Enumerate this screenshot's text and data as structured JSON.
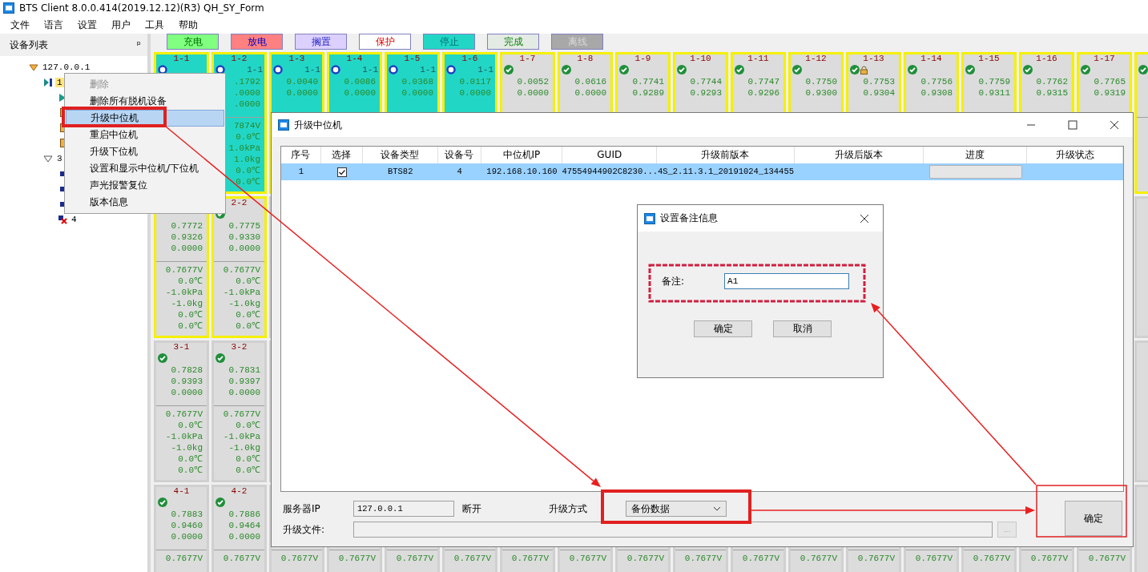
{
  "window": {
    "title": "BTS Client 8.0.0.414(2019.12.12)(R3) QH_SY_Form"
  },
  "menu_bar": [
    "文件",
    "语言",
    "设置",
    "用户",
    "工具",
    "帮助"
  ],
  "device_panel": {
    "title": "设备列表",
    "pin": "ᵖ",
    "nodes": [
      {
        "label": "127.0.0.1",
        "kind": "host",
        "expanded": true,
        "selected": false,
        "children": [
          {
            "label": "1",
            "kind": "unit",
            "selected": true,
            "children": [
              {
                "kind": "running",
                "selected": false
              },
              {
                "kind": "idle",
                "selected": false
              },
              {
                "kind": "idle",
                "selected": false
              },
              {
                "kind": "idle",
                "selected": false
              }
            ]
          },
          {
            "label": "3",
            "kind": "group",
            "expanded": true,
            "selected": false,
            "children": [
              {
                "kind": "channel",
                "selected": false
              },
              {
                "kind": "channel",
                "selected": false
              },
              {
                "kind": "channel",
                "selected": false
              },
              {
                "label": "4",
                "kind": "offline",
                "selected": false
              }
            ]
          }
        ]
      }
    ]
  },
  "context_menu": [
    {
      "label": "删除",
      "disabled": true,
      "selected": false
    },
    {
      "label": "删除所有脱机设备",
      "disabled": false,
      "selected": false
    },
    {
      "label": "升级中位机",
      "disabled": false,
      "selected": true
    },
    {
      "label": "重启中位机",
      "disabled": false,
      "selected": false
    },
    {
      "label": "升级下位机",
      "disabled": false,
      "selected": false
    },
    {
      "label": "设置和显示中位机/下位机",
      "disabled": false,
      "selected": false
    },
    {
      "label": "声光报警复位",
      "disabled": false,
      "selected": false
    },
    {
      "label": "版本信息",
      "disabled": false,
      "selected": false
    }
  ],
  "legend": [
    {
      "label": "充电",
      "color": "#80ff80"
    },
    {
      "label": "放电",
      "color": "#ff8080"
    },
    {
      "label": "搁置",
      "color": "#dcd0ff"
    },
    {
      "label": "保护",
      "color": "#ffffff"
    },
    {
      "label": "停止",
      "color": "#22d6c6"
    },
    {
      "label": "完成",
      "color": "#e4ebe4"
    },
    {
      "label": "离线",
      "color": "#a8a8a8"
    }
  ],
  "channel_grid": [
    [
      {
        "label": "1-1",
        "kind": "running",
        "selected": true,
        "locked": false
      },
      {
        "label": "1-2",
        "sub": "1-1",
        "kind": "running",
        "selected": true,
        "locked": false,
        "values": [
          ".1792",
          ".0000",
          ".0000"
        ],
        "readings": [
          "7874V",
          "0.0℃",
          "1.0kPa",
          "1.0kg",
          "0.0℃",
          "0.0℃"
        ]
      },
      {
        "label": "1-3",
        "sub": "1-1",
        "kind": "running",
        "selected": true,
        "locked": false,
        "values": [
          "0.0040",
          "0.0000"
        ]
      },
      {
        "label": "1-4",
        "sub": "1-1",
        "kind": "running",
        "selected": true,
        "locked": false,
        "values": [
          "0.0086",
          "0.0000"
        ]
      },
      {
        "label": "1-5",
        "sub": "1-1",
        "kind": "running",
        "selected": true,
        "locked": false,
        "values": [
          "0.0368",
          "0.0000"
        ]
      },
      {
        "label": "1-6",
        "sub": "1-1",
        "kind": "running",
        "selected": true,
        "locked": false,
        "values": [
          "0.0117",
          "0.0000"
        ]
      },
      {
        "label": "1-7",
        "kind": "done",
        "selected": true,
        "locked": false,
        "values": [
          "0.0052",
          "0.0000"
        ]
      },
      {
        "label": "1-8",
        "kind": "done",
        "selected": true,
        "locked": false,
        "values": [
          "0.0616",
          "0.0000"
        ]
      },
      {
        "label": "1-9",
        "kind": "done",
        "selected": true,
        "locked": false,
        "values": [
          "0.7741",
          "0.9289"
        ]
      },
      {
        "label": "1-10",
        "kind": "done",
        "selected": true,
        "locked": false,
        "values": [
          "0.7744",
          "0.9293"
        ]
      },
      {
        "label": "1-11",
        "kind": "done",
        "selected": true,
        "locked": false,
        "values": [
          "0.7747",
          "0.9296"
        ]
      },
      {
        "label": "1-12",
        "kind": "done",
        "selected": true,
        "locked": false,
        "values": [
          "0.7750",
          "0.9300"
        ]
      },
      {
        "label": "1-13",
        "kind": "done",
        "selected": true,
        "locked": true,
        "values": [
          "0.7753",
          "0.9304"
        ]
      },
      {
        "label": "1-14",
        "kind": "done",
        "selected": true,
        "locked": false,
        "values": [
          "0.7756",
          "0.9308"
        ]
      },
      {
        "label": "1-15",
        "kind": "done",
        "selected": true,
        "locked": false,
        "values": [
          "0.7759",
          "0.9311"
        ]
      },
      {
        "label": "1-16",
        "kind": "done",
        "selected": true,
        "locked": false,
        "values": [
          "0.7762",
          "0.9315"
        ]
      },
      {
        "label": "1-17",
        "kind": "done",
        "selected": true,
        "locked": false,
        "values": [
          "0.7765",
          "0.9319"
        ]
      },
      {
        "kind": "done",
        "selected": true
      }
    ],
    [
      {
        "selected": true,
        "values": [
          "0.7772",
          "0.9326",
          "0.0000"
        ],
        "readings": [
          "0.7677V",
          "0.0℃",
          "-1.0kPa",
          "-1.0kg",
          "0.0℃",
          "0.0℃"
        ]
      },
      {
        "label": "2-2",
        "kind": "done",
        "selected": true,
        "locked": false,
        "values": [
          "0.7775",
          "0.9330",
          "0.0000"
        ],
        "readings": [
          "0.7677V",
          "0.0℃",
          "-1.0kPa",
          "-1.0kg",
          "0.0℃",
          "0.0℃"
        ]
      }
    ],
    [
      {
        "label": "3-1",
        "kind": "done",
        "selected": false,
        "locked": false,
        "values": [
          "0.7828",
          "0.9393",
          "0.0000"
        ],
        "readings": [
          "0.7677V",
          "0.0℃",
          "-1.0kPa",
          "-1.0kg",
          "0.0℃",
          "0.0℃"
        ]
      },
      {
        "label": "3-2",
        "kind": "done",
        "selected": false,
        "locked": false,
        "values": [
          "0.7831",
          "0.9397",
          "0.0000"
        ],
        "readings": [
          "0.7677V",
          "0.0℃",
          "-1.0kPa",
          "-1.0kg",
          "0.0℃",
          "0.0℃"
        ]
      }
    ],
    [
      {
        "label": "4-1",
        "kind": "done",
        "selected": false,
        "locked": false,
        "values": [
          "0.7883",
          "0.9460",
          "0.0000"
        ],
        "readings": [
          "0.7677V"
        ]
      },
      {
        "label": "4-2",
        "kind": "done",
        "selected": false,
        "locked": false,
        "values": [
          "0.7886",
          "0.9464",
          "0.0000"
        ],
        "readings": [
          "0.7677V"
        ]
      },
      {
        "selected": false,
        "readings": [
          "0.7677V"
        ]
      },
      {
        "selected": false,
        "readings": [
          "0.7677V"
        ]
      },
      {
        "selected": false,
        "readings": [
          "0.7677V"
        ]
      },
      {
        "selected": false,
        "readings": [
          "0.7677V"
        ]
      },
      {
        "selected": false,
        "readings": [
          "0.7677V"
        ]
      },
      {
        "selected": false,
        "readings": [
          "0.7677V"
        ]
      },
      {
        "selected": false,
        "readings": [
          "0.7677V"
        ]
      },
      {
        "selected": false,
        "readings": [
          "0.7677V"
        ]
      },
      {
        "selected": false,
        "readings": [
          "0.7677V"
        ]
      },
      {
        "selected": false,
        "readings": [
          "0.7677V"
        ]
      },
      {
        "selected": false,
        "readings": [
          "0.7677V"
        ]
      },
      {
        "selected": false,
        "readings": [
          "0.7677V"
        ]
      },
      {
        "selected": false,
        "readings": [
          "0.7677V"
        ]
      },
      {
        "selected": false,
        "readings": [
          "0.7677V"
        ]
      },
      {
        "selected": false,
        "readings": [
          "0.7677V"
        ]
      }
    ]
  ],
  "upgrade_dialog": {
    "title": "升级中位机",
    "table": {
      "columns": [
        "序号",
        "选择",
        "设备类型",
        "设备号",
        "中位机IP",
        "GUID",
        "升级前版本",
        "升级后版本",
        "进度",
        "升级状态"
      ],
      "rows": [
        {
          "selected": true,
          "index": "1",
          "checked": true,
          "device_type": "BTS82",
          "device_no": "4",
          "ip": "192.168.10.160",
          "guid": "47554944902C8230...",
          "version_before": "4S_2.11.3.1_20191024_134455",
          "level": 0
        }
      ]
    },
    "server_ip_label": "服务器IP",
    "server_ip": "127.0.0.1",
    "connection": "断开",
    "mode_label": "升级方式",
    "mode": "备份数据",
    "file_label": "升级文件:",
    "browse": "...",
    "browse_disabled": true,
    "confirm": "确定"
  },
  "note_dialog": {
    "title": "设置备注信息",
    "label": "备注:",
    "value": "A1",
    "ok": "确定",
    "cancel": "取消"
  }
}
